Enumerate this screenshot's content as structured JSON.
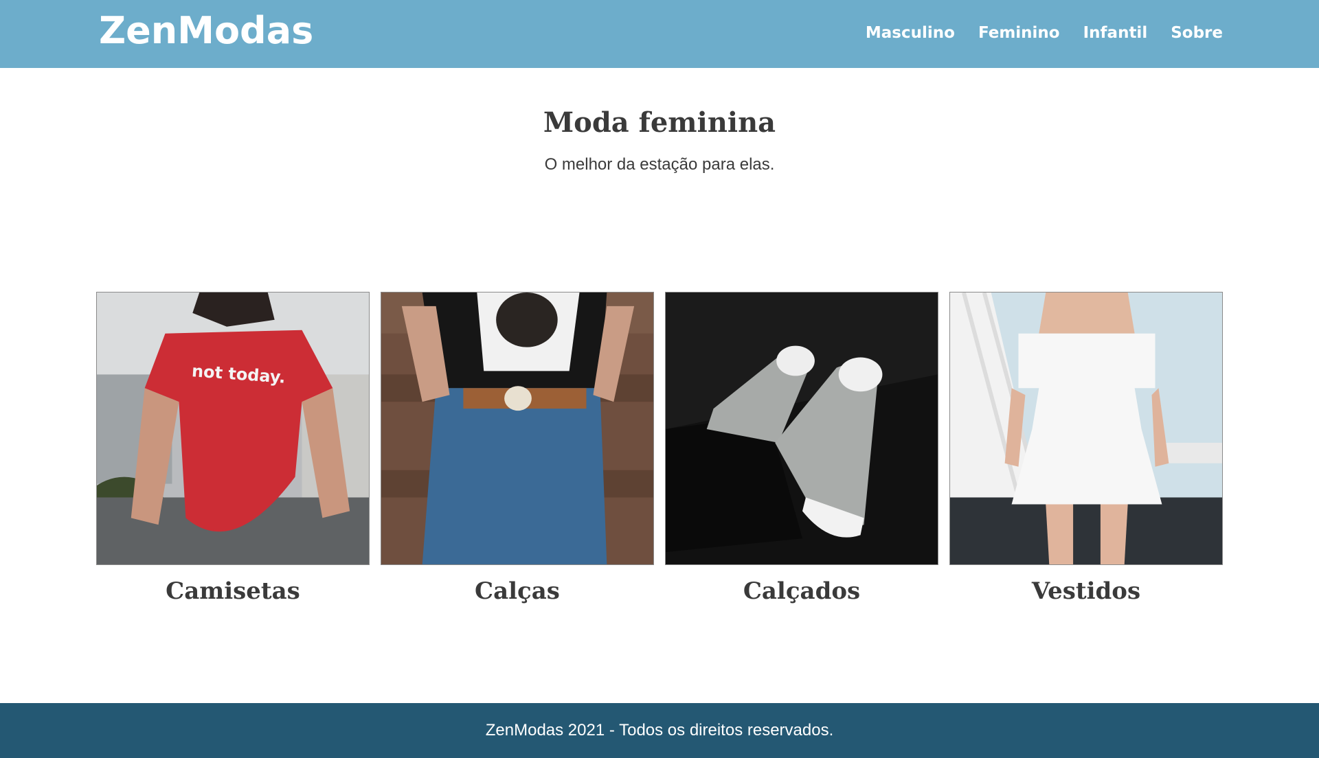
{
  "header": {
    "brand": "ZenModas",
    "nav": [
      "Masculino",
      "Feminino",
      "Infantil",
      "Sobre"
    ],
    "background": "#6dadcb"
  },
  "hero": {
    "title": "Moda feminina",
    "subtitle": "O melhor da estação para elas."
  },
  "categories": [
    {
      "label": "Camisetas",
      "image": "woman-red-tshirt-photo",
      "shirt_text": "not today."
    },
    {
      "label": "Calças",
      "image": "jeans-with-belt-photo"
    },
    {
      "label": "Calçados",
      "image": "gray-sneakers-photo"
    },
    {
      "label": "Vestidos",
      "image": "white-dress-photo"
    }
  ],
  "footer": {
    "text": "ZenModas 2021 - Todos os direitos reservados.",
    "background": "#245873"
  }
}
